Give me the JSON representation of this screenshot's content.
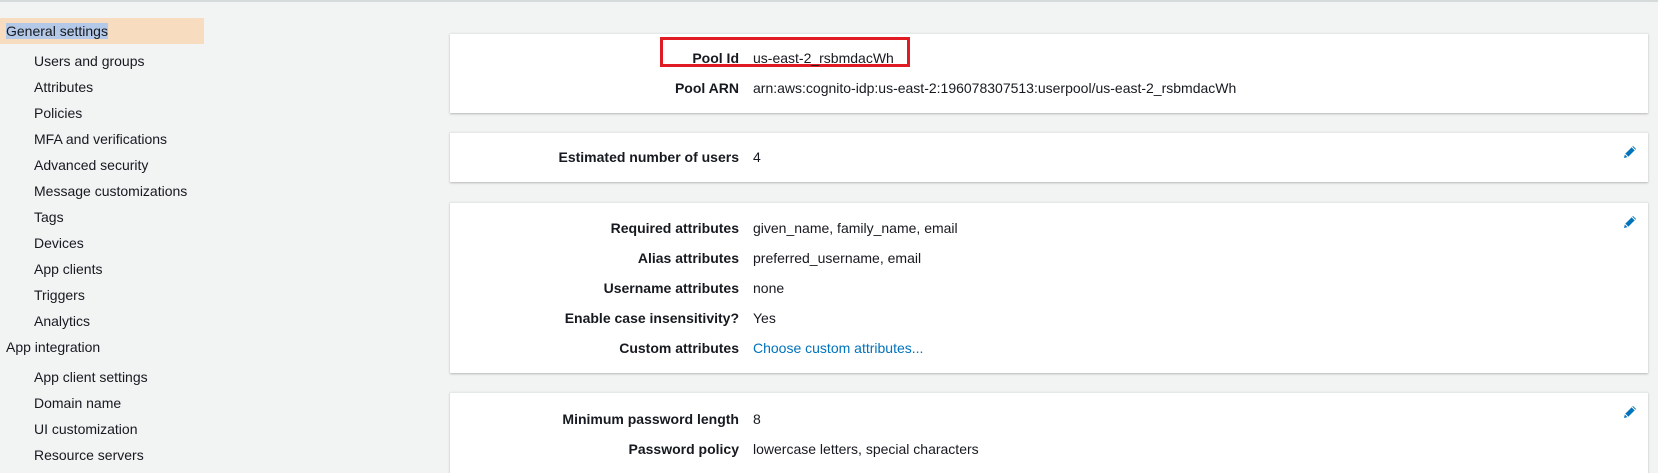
{
  "sidebar": {
    "general_settings": {
      "label": "General settings",
      "items": [
        {
          "label": "Users and groups"
        },
        {
          "label": "Attributes"
        },
        {
          "label": "Policies"
        },
        {
          "label": "MFA and verifications"
        },
        {
          "label": "Advanced security"
        },
        {
          "label": "Message customizations"
        },
        {
          "label": "Tags"
        },
        {
          "label": "Devices"
        },
        {
          "label": "App clients"
        },
        {
          "label": "Triggers"
        },
        {
          "label": "Analytics"
        }
      ]
    },
    "app_integration": {
      "label": "App integration",
      "items": [
        {
          "label": "App client settings"
        },
        {
          "label": "Domain name"
        },
        {
          "label": "UI customization"
        },
        {
          "label": "Resource servers"
        }
      ]
    }
  },
  "pool_panel": {
    "pool_id_label": "Pool Id",
    "pool_id_value": "us-east-2_rsbmdacWh",
    "pool_arn_label": "Pool ARN",
    "pool_arn_value": "arn:aws:cognito-idp:us-east-2:196078307513:userpool/us-east-2_rsbmdacWh"
  },
  "users_panel": {
    "label": "Estimated number of users",
    "value": "4"
  },
  "attributes_panel": {
    "rows": [
      {
        "label": "Required attributes",
        "value": "given_name, family_name, email"
      },
      {
        "label": "Alias attributes",
        "value": "preferred_username, email"
      },
      {
        "label": "Username attributes",
        "value": "none"
      },
      {
        "label": "Enable case insensitivity?",
        "value": "Yes"
      },
      {
        "label": "Custom attributes",
        "value": "Choose custom attributes..."
      }
    ]
  },
  "password_panel": {
    "rows": [
      {
        "label": "Minimum password length",
        "value": "8"
      },
      {
        "label": "Password policy",
        "value": "lowercase letters, special characters"
      }
    ]
  },
  "colors": {
    "accent_link": "#0073bb",
    "highlight_border": "#e01b24",
    "active_nav_bg": "#f8dcbf",
    "selection_bg": "#b4c9e8"
  },
  "icons": {
    "edit": "pencil-icon"
  }
}
